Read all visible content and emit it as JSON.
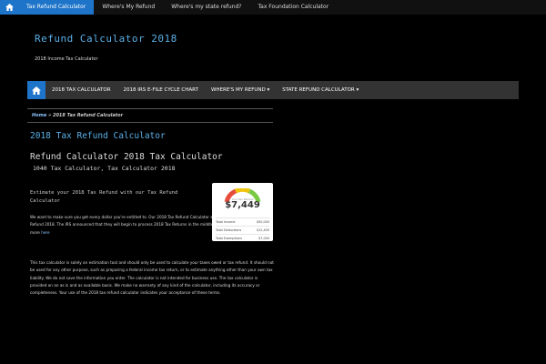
{
  "topnav": {
    "items": [
      {
        "label": "Tax Refund Calculator",
        "active": true
      },
      {
        "label": "Where's My Refund",
        "active": false
      },
      {
        "label": "Where's my state refund?",
        "active": false
      },
      {
        "label": "Tax Foundation Calculator",
        "active": false
      }
    ],
    "home_icon": "home-icon",
    "accent": "#1e74c9"
  },
  "site": {
    "title": "Refund Calculator 2018",
    "description": "2018 Income Tax Calculator"
  },
  "mainnav": {
    "items": [
      {
        "label": "2018 TAX CALCULATOR"
      },
      {
        "label": "2018 IRS E-FILE CYCLE CHART"
      },
      {
        "label": "WHERE'S MY REFUND ▾"
      },
      {
        "label": "STATE REFUND CALCULATOR ▾"
      }
    ]
  },
  "breadcrumb": {
    "home": "Home",
    "separator": " » ",
    "current": "2018 Tax Refund Calculator"
  },
  "page": {
    "title": "2018 Tax Refund Calculator",
    "subtitle": "Refund Calculator 2018 Tax Calculator",
    "subsubtitle": "1040 Tax Calculator, Tax Calculator 2018",
    "lead": "Estimate your 2018 Tax Refund with our Tax Refund Calculator",
    "p1_text": "We want to make sure you get every dollar you're entitled to. Our 2018 Tax Refund Calculator shows the your estimated Tax Refund 2018. The IRS announced that they will begin to process 2018 Tax Returns in the middle of January, 2018. Find out more ",
    "p1_link": "here",
    "p2": "This tax calculator is solely an estimation tool and should only be used to calculate your taxes owed or tax refund. It should not be used for any other purpose, such as preparing a federal income tax return, or to estimate anything other than your own tax liability. We do not save the information you enter. The calculator is not intended for business use. The tax calculator is provided on an as is and as available basis. We make no warranty of any kind of the calculator, including its accuracy or completeness. Your use of the 2018 tax refund calculator indicates your acceptance of these terms."
  },
  "widget": {
    "caption": "Your Tax Refund",
    "amount": "$7,449",
    "rows": [
      {
        "label": "Total Income",
        "value": "$50,000"
      },
      {
        "label": "Total Deductions",
        "value": "$12,400"
      },
      {
        "label": "Total Exemptions",
        "value": "$7,000"
      }
    ],
    "gauge_colors": [
      "#e74c3c",
      "#f1c40f",
      "#7ac943"
    ]
  }
}
